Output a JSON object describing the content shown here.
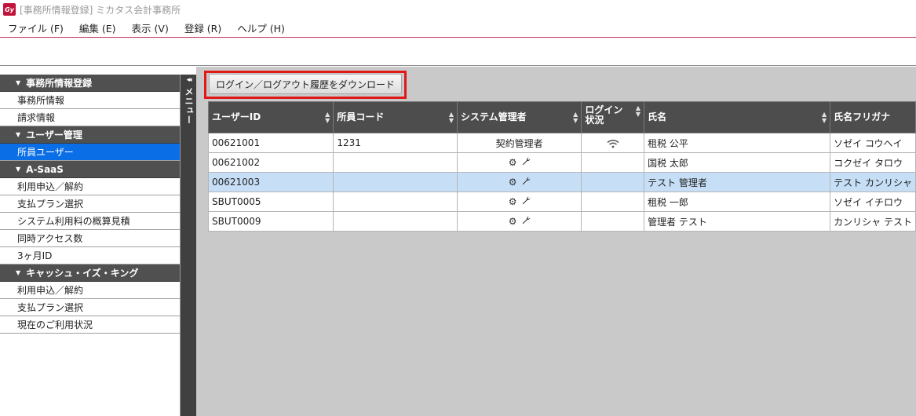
{
  "window": {
    "icon_text": "Gy",
    "title": "[事務所情報登録] ミカタス会計事務所"
  },
  "menubar": {
    "items": [
      "ファイル (F)",
      "編集 (E)",
      "表示 (V)",
      "登録 (R)",
      "ヘルプ (H)"
    ]
  },
  "sidebar": {
    "sections": [
      {
        "header": "事務所情報登録",
        "items": [
          "事務所情報",
          "請求情報"
        ]
      },
      {
        "header": "ユーザー管理",
        "items": [
          "所員ユーザー"
        ]
      },
      {
        "header": "A-SaaS",
        "items": [
          "利用申込／解約",
          "支払プラン選択",
          "システム利用料の概算見積",
          "同時アクセス数",
          "3ヶ月ID"
        ]
      },
      {
        "header": "キャッシュ・イズ・キング",
        "items": [
          "利用申込／解約",
          "支払プラン選択",
          "現在のご利用状況"
        ]
      }
    ],
    "active_item": "所員ユーザー",
    "collapse_label": "メニュー",
    "collapse_arrows": "◂◂"
  },
  "main": {
    "download_button": "ログイン／ログアウト履歴をダウンロード",
    "columns": [
      "ユーザーID",
      "所員コード",
      "システム管理者",
      "ログイン状況",
      "氏名",
      "氏名フリガナ"
    ],
    "rows": [
      {
        "user_id": "00621001",
        "staff_code": "1231",
        "admin": "契約管理者",
        "admin_icons": false,
        "login_online": true,
        "name": "租税 公平",
        "kana": "ソゼイ コウヘイ",
        "selected": false
      },
      {
        "user_id": "00621002",
        "staff_code": "",
        "admin": "",
        "admin_icons": true,
        "login_online": false,
        "name": "国税 太郎",
        "kana": "コクゼイ タロウ",
        "selected": false
      },
      {
        "user_id": "00621003",
        "staff_code": "",
        "admin": "",
        "admin_icons": true,
        "login_online": false,
        "name": "テスト 管理者",
        "kana": "テスト カンリシャ",
        "selected": true
      },
      {
        "user_id": "SBUT0005",
        "staff_code": "",
        "admin": "",
        "admin_icons": true,
        "login_online": false,
        "name": "租税 一郎",
        "kana": "ソゼイ イチロウ",
        "selected": false
      },
      {
        "user_id": "SBUT0009",
        "staff_code": "",
        "admin": "",
        "admin_icons": true,
        "login_online": false,
        "name": "管理者 テスト",
        "kana": "カンリシャ テスト",
        "selected": false
      }
    ]
  },
  "colors": {
    "accent_active": "#0a6ee6",
    "selected_row": "#c6dff7",
    "highlight_border": "#e01818",
    "header_bg": "#4d4d4d"
  }
}
